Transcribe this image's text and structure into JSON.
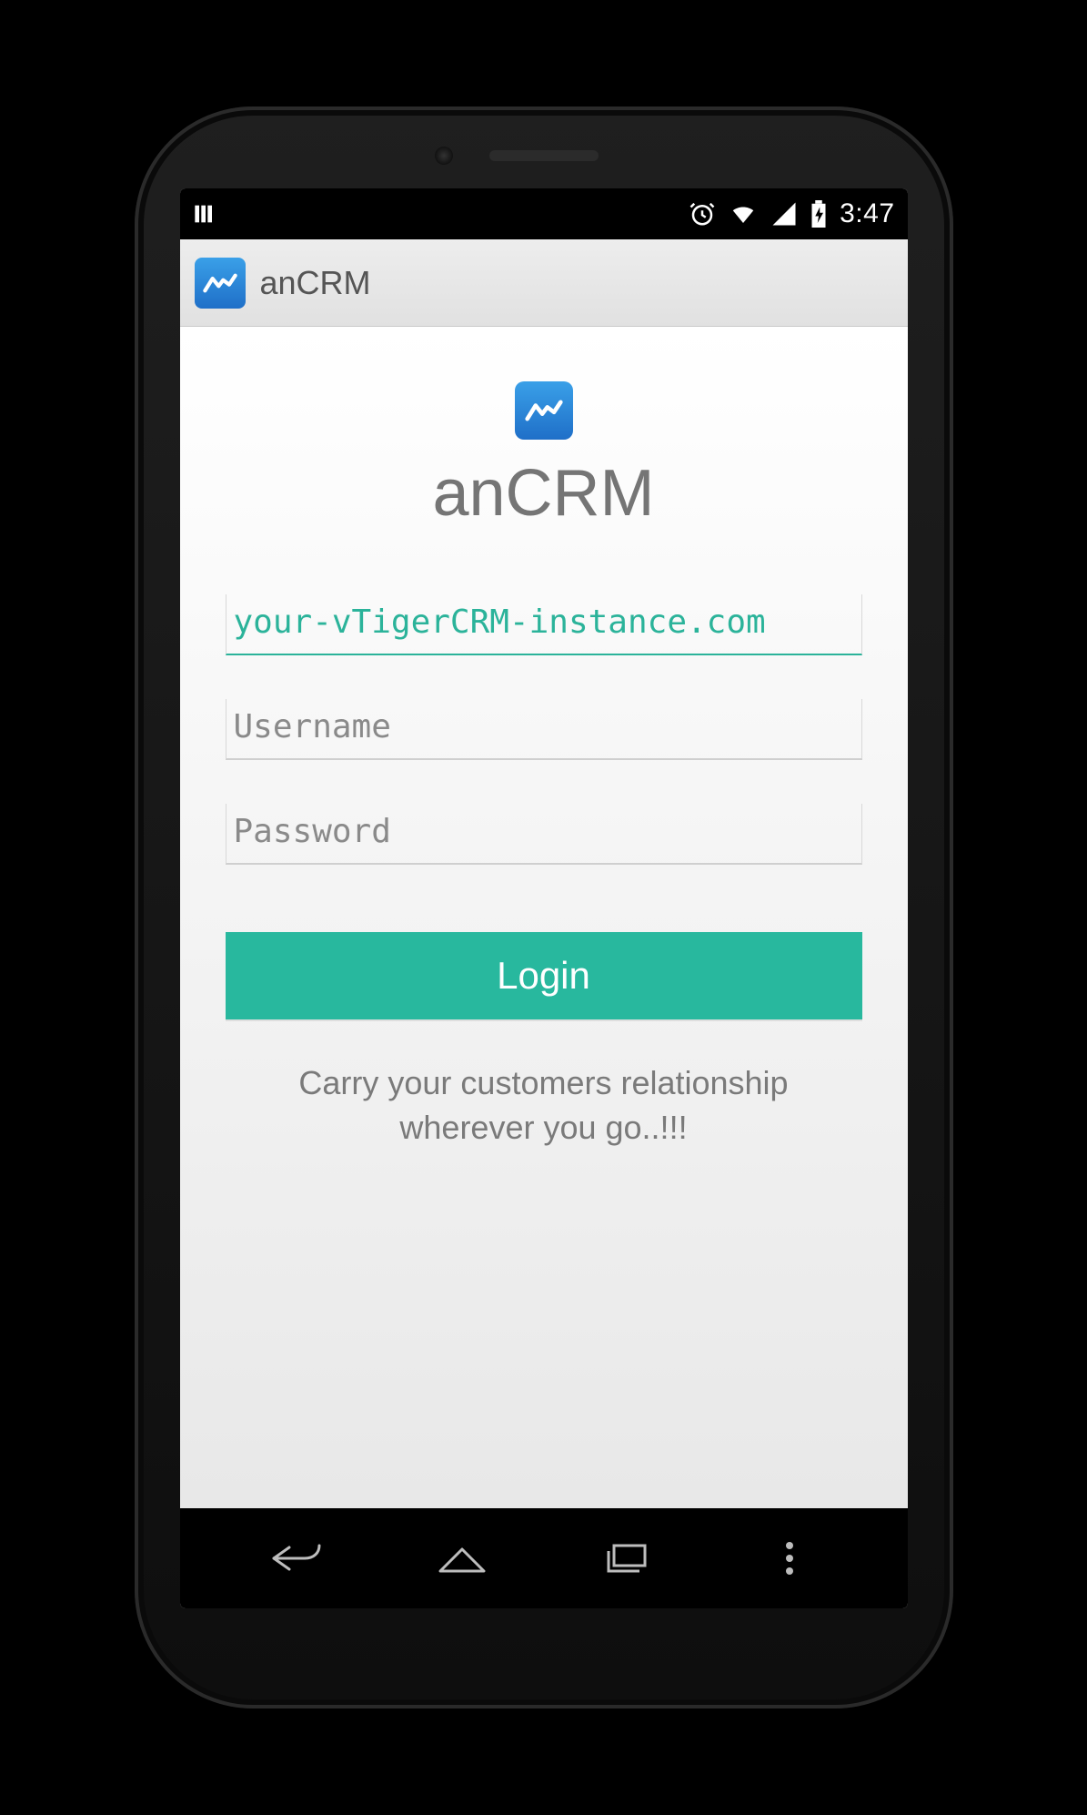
{
  "statusbar": {
    "time": "3:47"
  },
  "actionbar": {
    "title": "anCRM"
  },
  "logo": {
    "title": "anCRM"
  },
  "form": {
    "instance_placeholder": "your-vTigerCRM-instance.com",
    "username_placeholder": "Username",
    "password_placeholder": "Password",
    "login_label": "Login"
  },
  "tagline": "Carry your customers relationship wherever you go..!!!",
  "colors": {
    "accent": "#28b89e",
    "icon_gradient_top": "#3aa0e8",
    "icon_gradient_bottom": "#1f6fc8"
  }
}
